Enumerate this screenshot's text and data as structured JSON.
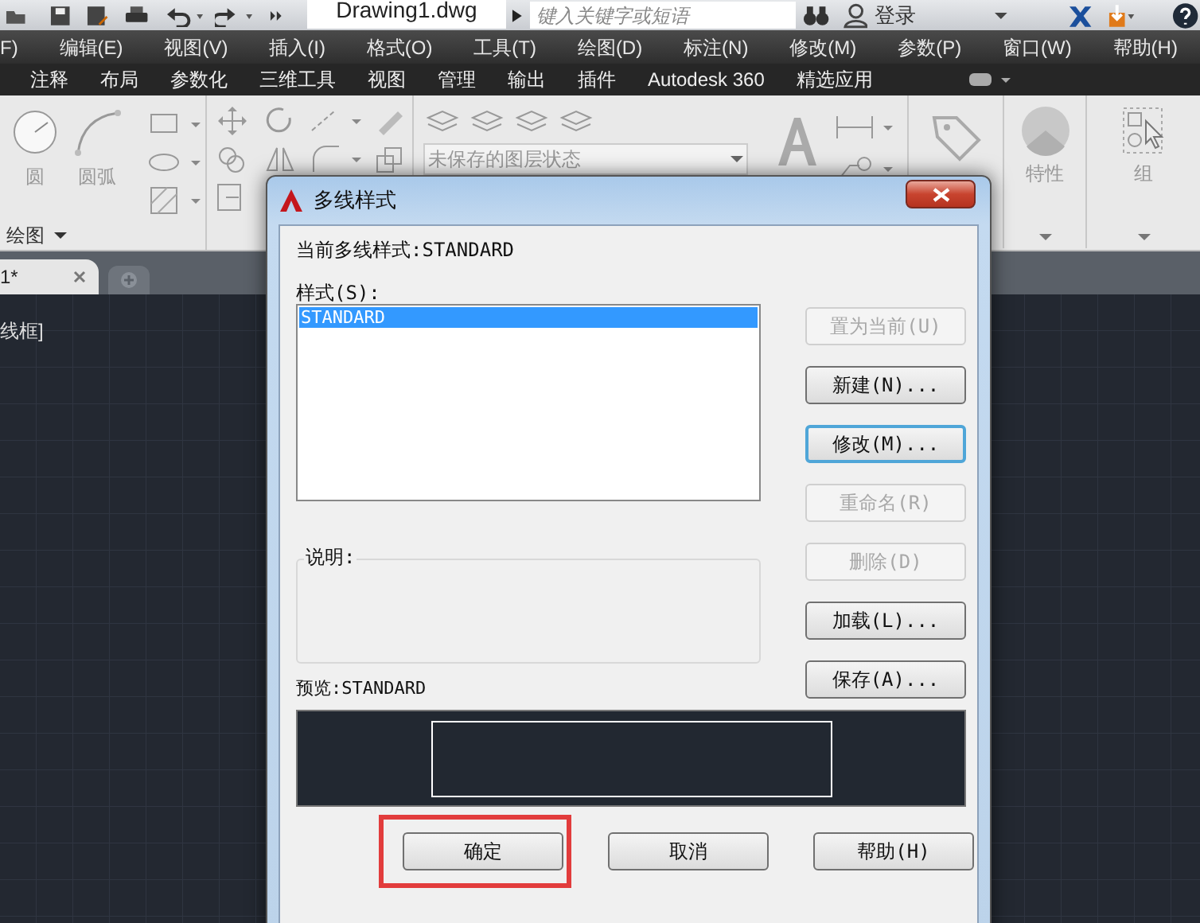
{
  "title_bar": {
    "file_tab": "Drawing1.dwg",
    "search_placeholder": "键入关键字或短语",
    "login": "登录"
  },
  "menu": [
    "F)",
    "编辑(E)",
    "视图(V)",
    "插入(I)",
    "格式(O)",
    "工具(T)",
    "绘图(D)",
    "标注(N)",
    "修改(M)",
    "参数(P)",
    "窗口(W)",
    "帮助(H)"
  ],
  "ribbon_tabs": [
    "注释",
    "布局",
    "参数化",
    "三维工具",
    "视图",
    "管理",
    "输出",
    "插件",
    "Autodesk 360",
    "精选应用"
  ],
  "ribbon": {
    "circle": "圆",
    "arc": "圆弧",
    "draw_panel": "绘图",
    "layer_state": "未保存的图层状态",
    "properties": "特性",
    "group": "组"
  },
  "doc_tab": "1*",
  "viewport_label": "线框]",
  "dialog": {
    "title": "多线样式",
    "current": "当前多线样式:STANDARD",
    "styles_label": "样式(S):",
    "styles": [
      {
        "name": "STANDARD",
        "selected": true
      }
    ],
    "side_buttons": [
      {
        "label": "置为当前(U)",
        "disabled": true,
        "focused": false
      },
      {
        "label": "新建(N)...",
        "disabled": false,
        "focused": false
      },
      {
        "label": "修改(M)...",
        "disabled": false,
        "focused": true
      },
      {
        "label": "重命名(R)",
        "disabled": true,
        "focused": false
      },
      {
        "label": "删除(D)",
        "disabled": true,
        "focused": false
      },
      {
        "label": "加载(L)...",
        "disabled": false,
        "focused": false
      },
      {
        "label": "保存(A)...",
        "disabled": false,
        "focused": false
      }
    ],
    "description_label": "说明:",
    "preview_label": "预览:STANDARD",
    "footer_buttons": [
      {
        "label": "确定",
        "highlighted": true
      },
      {
        "label": "取消",
        "highlighted": false
      },
      {
        "label": "帮助(H)",
        "highlighted": false
      }
    ]
  }
}
